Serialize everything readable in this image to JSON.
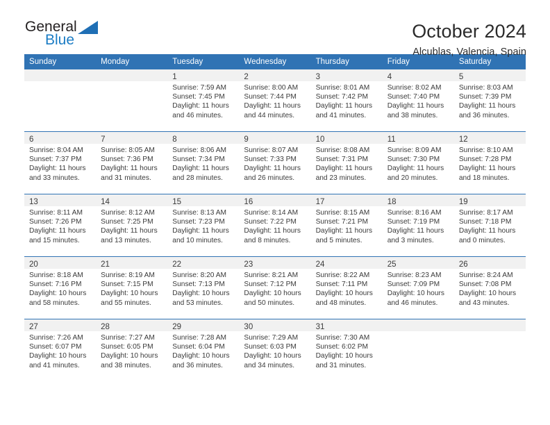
{
  "brand": {
    "name_top": "General",
    "name_bottom": "Blue",
    "accent_color": "#1f6fb5"
  },
  "header": {
    "title": "October 2024",
    "subtitle": "Alcublas, Valencia, Spain"
  },
  "theme": {
    "header_blue": "#3073b4",
    "daynum_band": "#f1f1f1",
    "text": "#3a3a3a"
  },
  "weekday_headers": [
    "Sunday",
    "Monday",
    "Tuesday",
    "Wednesday",
    "Thursday",
    "Friday",
    "Saturday"
  ],
  "labels": {
    "sunrise_prefix": "Sunrise:",
    "sunset_prefix": "Sunset:",
    "daylight_prefix": "Daylight:"
  },
  "weeks": [
    [
      {
        "day": "",
        "sunrise": "",
        "sunset": "",
        "daylight": "",
        "empty": true
      },
      {
        "day": "",
        "sunrise": "",
        "sunset": "",
        "daylight": "",
        "empty": true
      },
      {
        "day": "1",
        "sunrise": "Sunrise: 7:59 AM",
        "sunset": "Sunset: 7:45 PM",
        "daylight": "Daylight: 11 hours and 46 minutes."
      },
      {
        "day": "2",
        "sunrise": "Sunrise: 8:00 AM",
        "sunset": "Sunset: 7:44 PM",
        "daylight": "Daylight: 11 hours and 44 minutes."
      },
      {
        "day": "3",
        "sunrise": "Sunrise: 8:01 AM",
        "sunset": "Sunset: 7:42 PM",
        "daylight": "Daylight: 11 hours and 41 minutes."
      },
      {
        "day": "4",
        "sunrise": "Sunrise: 8:02 AM",
        "sunset": "Sunset: 7:40 PM",
        "daylight": "Daylight: 11 hours and 38 minutes."
      },
      {
        "day": "5",
        "sunrise": "Sunrise: 8:03 AM",
        "sunset": "Sunset: 7:39 PM",
        "daylight": "Daylight: 11 hours and 36 minutes."
      }
    ],
    [
      {
        "day": "6",
        "sunrise": "Sunrise: 8:04 AM",
        "sunset": "Sunset: 7:37 PM",
        "daylight": "Daylight: 11 hours and 33 minutes."
      },
      {
        "day": "7",
        "sunrise": "Sunrise: 8:05 AM",
        "sunset": "Sunset: 7:36 PM",
        "daylight": "Daylight: 11 hours and 31 minutes."
      },
      {
        "day": "8",
        "sunrise": "Sunrise: 8:06 AM",
        "sunset": "Sunset: 7:34 PM",
        "daylight": "Daylight: 11 hours and 28 minutes."
      },
      {
        "day": "9",
        "sunrise": "Sunrise: 8:07 AM",
        "sunset": "Sunset: 7:33 PM",
        "daylight": "Daylight: 11 hours and 26 minutes."
      },
      {
        "day": "10",
        "sunrise": "Sunrise: 8:08 AM",
        "sunset": "Sunset: 7:31 PM",
        "daylight": "Daylight: 11 hours and 23 minutes."
      },
      {
        "day": "11",
        "sunrise": "Sunrise: 8:09 AM",
        "sunset": "Sunset: 7:30 PM",
        "daylight": "Daylight: 11 hours and 20 minutes."
      },
      {
        "day": "12",
        "sunrise": "Sunrise: 8:10 AM",
        "sunset": "Sunset: 7:28 PM",
        "daylight": "Daylight: 11 hours and 18 minutes."
      }
    ],
    [
      {
        "day": "13",
        "sunrise": "Sunrise: 8:11 AM",
        "sunset": "Sunset: 7:26 PM",
        "daylight": "Daylight: 11 hours and 15 minutes."
      },
      {
        "day": "14",
        "sunrise": "Sunrise: 8:12 AM",
        "sunset": "Sunset: 7:25 PM",
        "daylight": "Daylight: 11 hours and 13 minutes."
      },
      {
        "day": "15",
        "sunrise": "Sunrise: 8:13 AM",
        "sunset": "Sunset: 7:23 PM",
        "daylight": "Daylight: 11 hours and 10 minutes."
      },
      {
        "day": "16",
        "sunrise": "Sunrise: 8:14 AM",
        "sunset": "Sunset: 7:22 PM",
        "daylight": "Daylight: 11 hours and 8 minutes."
      },
      {
        "day": "17",
        "sunrise": "Sunrise: 8:15 AM",
        "sunset": "Sunset: 7:21 PM",
        "daylight": "Daylight: 11 hours and 5 minutes."
      },
      {
        "day": "18",
        "sunrise": "Sunrise: 8:16 AM",
        "sunset": "Sunset: 7:19 PM",
        "daylight": "Daylight: 11 hours and 3 minutes."
      },
      {
        "day": "19",
        "sunrise": "Sunrise: 8:17 AM",
        "sunset": "Sunset: 7:18 PM",
        "daylight": "Daylight: 11 hours and 0 minutes."
      }
    ],
    [
      {
        "day": "20",
        "sunrise": "Sunrise: 8:18 AM",
        "sunset": "Sunset: 7:16 PM",
        "daylight": "Daylight: 10 hours and 58 minutes."
      },
      {
        "day": "21",
        "sunrise": "Sunrise: 8:19 AM",
        "sunset": "Sunset: 7:15 PM",
        "daylight": "Daylight: 10 hours and 55 minutes."
      },
      {
        "day": "22",
        "sunrise": "Sunrise: 8:20 AM",
        "sunset": "Sunset: 7:13 PM",
        "daylight": "Daylight: 10 hours and 53 minutes."
      },
      {
        "day": "23",
        "sunrise": "Sunrise: 8:21 AM",
        "sunset": "Sunset: 7:12 PM",
        "daylight": "Daylight: 10 hours and 50 minutes."
      },
      {
        "day": "24",
        "sunrise": "Sunrise: 8:22 AM",
        "sunset": "Sunset: 7:11 PM",
        "daylight": "Daylight: 10 hours and 48 minutes."
      },
      {
        "day": "25",
        "sunrise": "Sunrise: 8:23 AM",
        "sunset": "Sunset: 7:09 PM",
        "daylight": "Daylight: 10 hours and 46 minutes."
      },
      {
        "day": "26",
        "sunrise": "Sunrise: 8:24 AM",
        "sunset": "Sunset: 7:08 PM",
        "daylight": "Daylight: 10 hours and 43 minutes."
      }
    ],
    [
      {
        "day": "27",
        "sunrise": "Sunrise: 7:26 AM",
        "sunset": "Sunset: 6:07 PM",
        "daylight": "Daylight: 10 hours and 41 minutes."
      },
      {
        "day": "28",
        "sunrise": "Sunrise: 7:27 AM",
        "sunset": "Sunset: 6:05 PM",
        "daylight": "Daylight: 10 hours and 38 minutes."
      },
      {
        "day": "29",
        "sunrise": "Sunrise: 7:28 AM",
        "sunset": "Sunset: 6:04 PM",
        "daylight": "Daylight: 10 hours and 36 minutes."
      },
      {
        "day": "30",
        "sunrise": "Sunrise: 7:29 AM",
        "sunset": "Sunset: 6:03 PM",
        "daylight": "Daylight: 10 hours and 34 minutes."
      },
      {
        "day": "31",
        "sunrise": "Sunrise: 7:30 AM",
        "sunset": "Sunset: 6:02 PM",
        "daylight": "Daylight: 10 hours and 31 minutes."
      },
      {
        "day": "",
        "sunrise": "",
        "sunset": "",
        "daylight": "",
        "empty": true
      },
      {
        "day": "",
        "sunrise": "",
        "sunset": "",
        "daylight": "",
        "empty": true
      }
    ]
  ]
}
